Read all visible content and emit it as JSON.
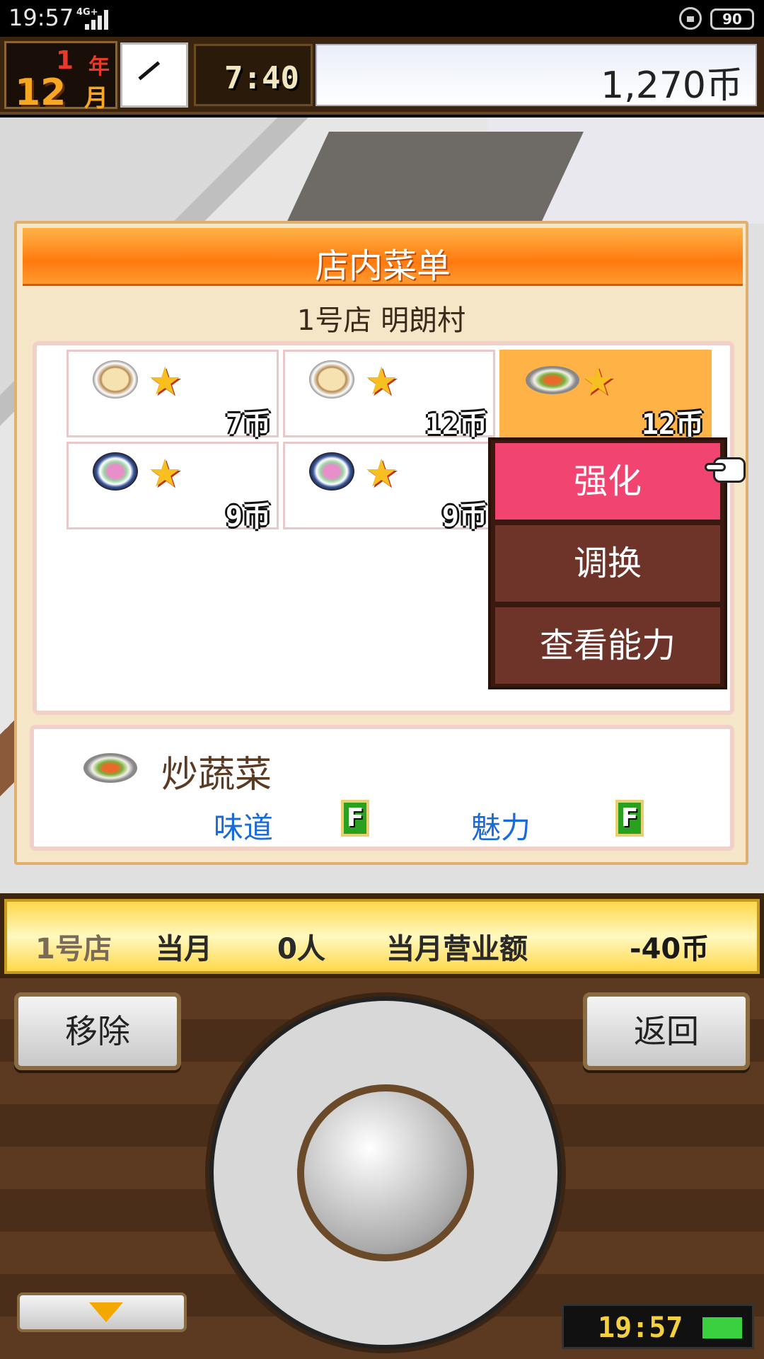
{
  "status_bar": {
    "time": "19:57",
    "network": "4G+",
    "battery": "90"
  },
  "hud": {
    "year_num": "1",
    "year_label": "年",
    "month_num": "12",
    "month_label": "月",
    "game_time": "7:40",
    "money": "1,270币"
  },
  "panel": {
    "title": "店内菜单",
    "shop_name": "1号店 明朗村",
    "items": [
      {
        "price": "7币"
      },
      {
        "price": "12币"
      },
      {
        "price": "12币"
      },
      {
        "price": "9币"
      },
      {
        "price": "9币"
      }
    ],
    "context_menu": [
      "强化",
      "调换",
      "查看能力"
    ],
    "detail": {
      "name": "炒蔬菜",
      "taste_label": "味道",
      "taste_grade": "F",
      "charm_label": "魅力",
      "charm_grade": "F"
    }
  },
  "strip": {
    "shop": "1号店",
    "month": "当月",
    "visitors": "0人",
    "sales_label": "当月营业额",
    "sales_value": "-40币"
  },
  "controls": {
    "remove": "移除",
    "back": "返回",
    "clock": "19:57"
  }
}
